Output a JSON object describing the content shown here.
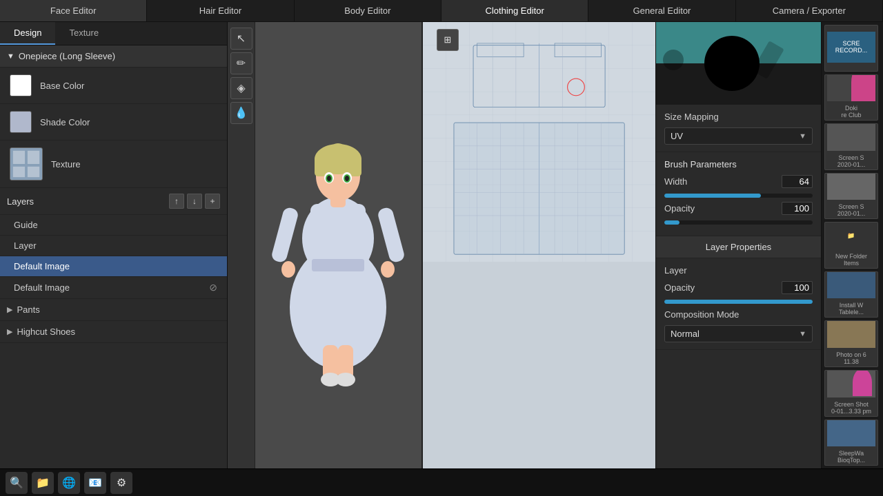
{
  "nav": {
    "items": [
      {
        "id": "face-editor",
        "label": "Face Editor"
      },
      {
        "id": "hair-editor",
        "label": "Hair Editor"
      },
      {
        "id": "body-editor",
        "label": "Body Editor"
      },
      {
        "id": "clothing-editor",
        "label": "Clothing Editor",
        "active": true
      },
      {
        "id": "general-editor",
        "label": "General Editor"
      },
      {
        "id": "camera-exporter",
        "label": "Camera / Exporter"
      }
    ]
  },
  "left_panel": {
    "tabs": [
      {
        "id": "design",
        "label": "Design",
        "active": true
      },
      {
        "id": "texture",
        "label": "Texture"
      }
    ],
    "clothing_item": "Onepiece (Long Sleeve)",
    "base_color_label": "Base Color",
    "shade_color_label": "Shade Color",
    "texture_label": "Texture",
    "layers_title": "Layers",
    "layer_up_label": "↑",
    "layer_down_label": "↓",
    "layer_add_label": "+",
    "layers": [
      {
        "name": "Guide",
        "selected": false,
        "hidden": false
      },
      {
        "name": "Layer",
        "selected": false,
        "hidden": false
      },
      {
        "name": "Default Image",
        "selected": true,
        "hidden": false
      },
      {
        "name": "Default Image",
        "selected": false,
        "hidden": true
      }
    ],
    "sub_sections": [
      {
        "name": "Pants",
        "expanded": false
      },
      {
        "name": "Highcut Shoes",
        "expanded": false
      }
    ]
  },
  "right_panel": {
    "size_mapping_label": "Size Mapping",
    "size_mapping_value": "UV",
    "brush_params_label": "Brush Parameters",
    "width_label": "Width",
    "width_value": "64",
    "width_fill_pct": 65,
    "opacity_label": "Opacity",
    "opacity_value": "100",
    "opacity_fill_pct": 10,
    "layer_props_label": "Layer Properties",
    "layer_label": "Layer",
    "layer_opacity_label": "Opacity",
    "layer_opacity_value": "100",
    "layer_opacity_fill_pct": 100,
    "composition_mode_label": "Composition Mode",
    "composition_mode_value": "Normal"
  },
  "screenshots": [
    {
      "label": "SCRE\nRECORD..."
    },
    {
      "label": "Doki\nre Club"
    },
    {
      "label": "Screen S\n2020-01..."
    },
    {
      "label": "Screen S\n2020-01..."
    },
    {
      "label": "New Folder\nItems"
    },
    {
      "label": "Install W\nTablele..."
    },
    {
      "label": "Photo on 6\n11.38"
    },
    {
      "label": "Screen Shot\n0-01...3.33 pm"
    },
    {
      "label": "SleepWa\nBiogTop..."
    }
  ],
  "tools": [
    {
      "id": "cursor",
      "symbol": "↖",
      "active": false
    },
    {
      "id": "pencil",
      "symbol": "✏",
      "active": false
    },
    {
      "id": "eraser",
      "symbol": "◈",
      "active": false
    },
    {
      "id": "fill",
      "symbol": "💧",
      "active": false
    }
  ],
  "align_button_symbol": "⊞"
}
